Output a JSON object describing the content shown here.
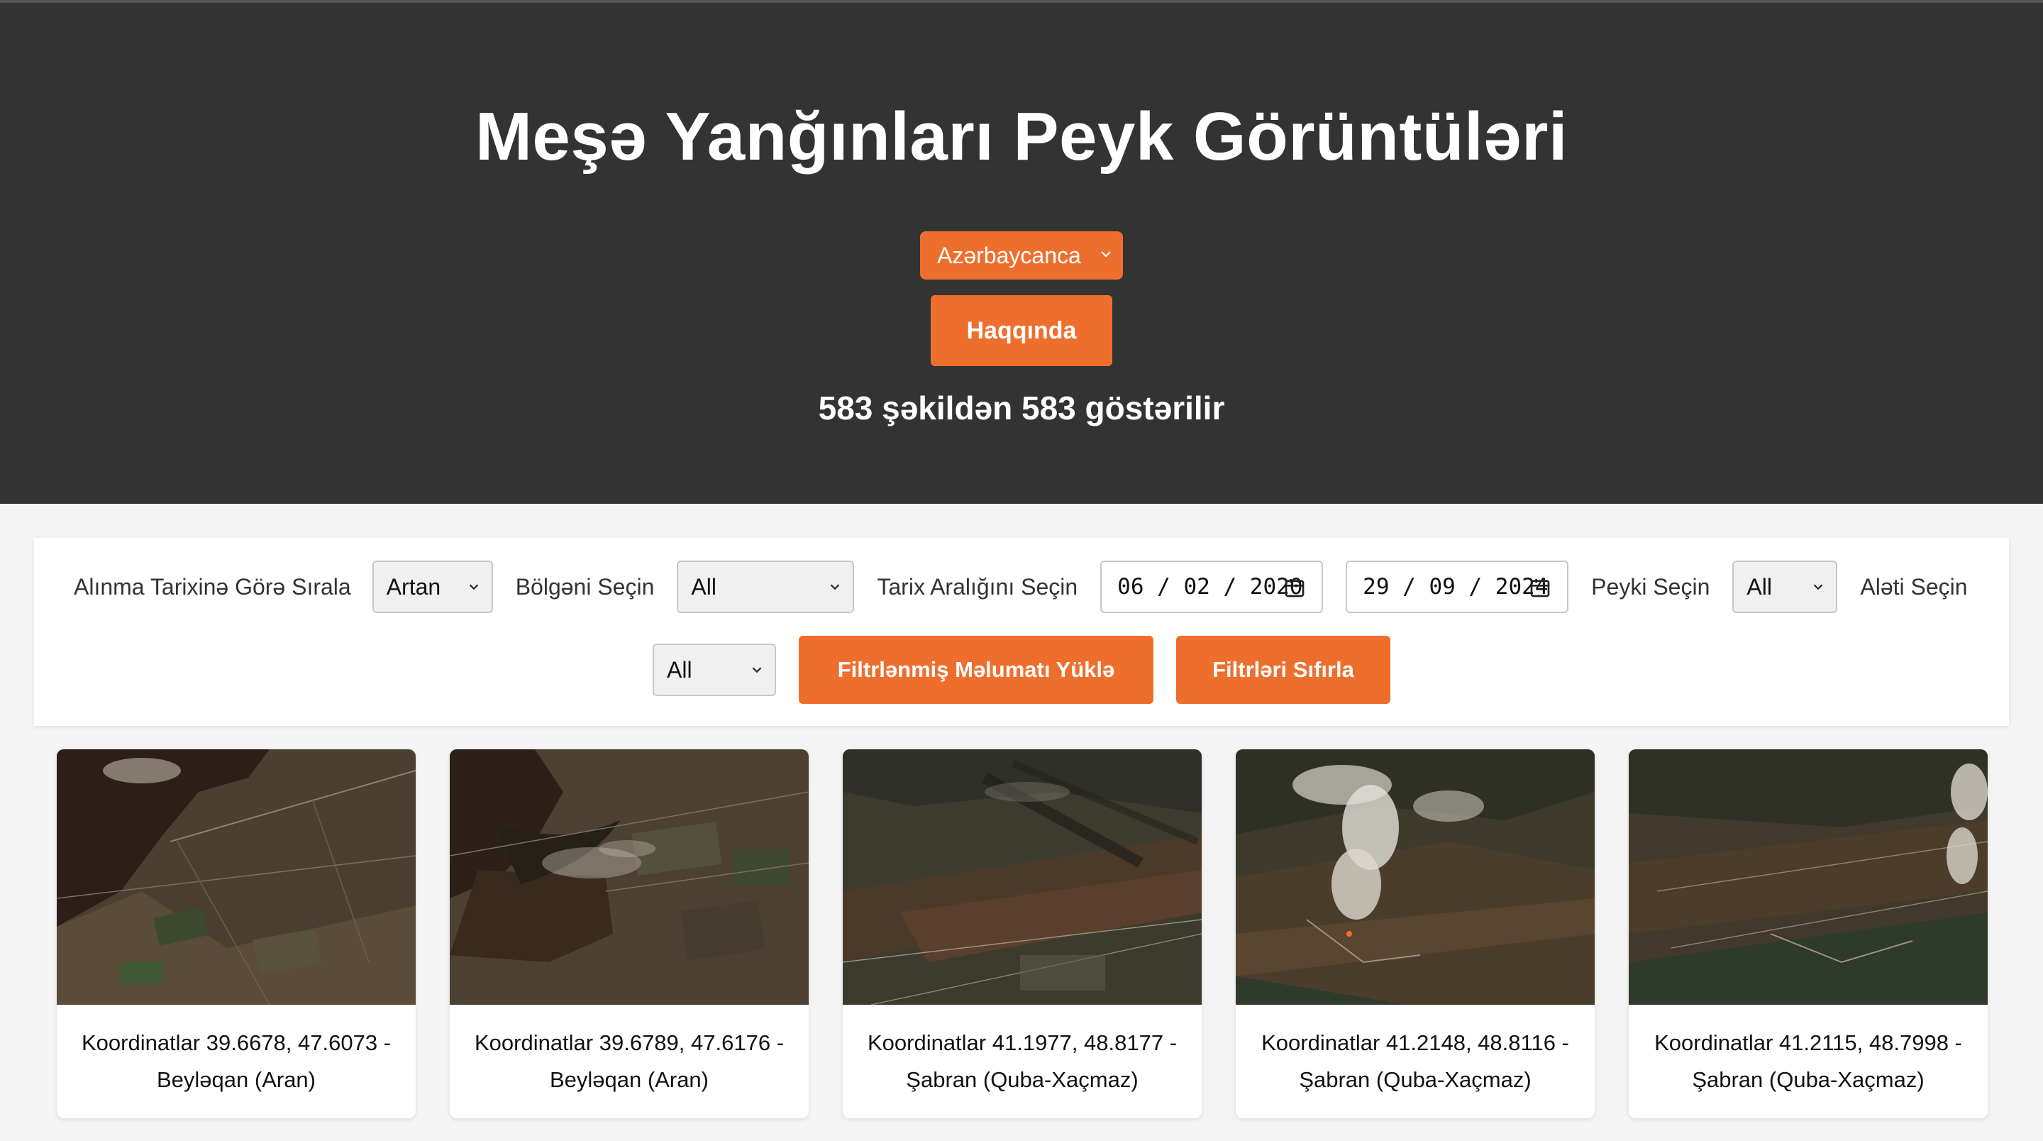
{
  "header": {
    "title": "Meşə Yanğınları Peyk Görüntüləri",
    "language_selected": "Azərbaycanca",
    "about_label": "Haqqında",
    "count_text": "583 şəkildən 583 göstərilir"
  },
  "filters": {
    "sort_label": "Alınma Tarixinə Görə Sırala",
    "sort_value": "Artan",
    "region_label": "Bölgəni Seçin",
    "region_value": "All",
    "date_range_label": "Tarix Aralığını Seçin",
    "date_from": "06 / 02 / 2020",
    "date_to": "29 / 09 / 2024",
    "satellite_label": "Peyki Seçin",
    "satellite_value": "All",
    "instrument_label": "Aləti Seçin",
    "instrument_value": "All",
    "load_button": "Filtrlənmiş Məlumatı Yüklə",
    "reset_button": "Filtrləri Sıfırla"
  },
  "cards": [
    {
      "line1": "Koordinatlar 39.6678, 47.6073 -",
      "line2": "Beyləqan (Aran)"
    },
    {
      "line1": "Koordinatlar 39.6789, 47.6176 -",
      "line2": "Beyləqan (Aran)"
    },
    {
      "line1": "Koordinatlar 41.1977, 48.8177 -",
      "line2": "Şabran (Quba-Xaçmaz)"
    },
    {
      "line1": "Koordinatlar 41.2148, 48.8116 -",
      "line2": "Şabran (Quba-Xaçmaz)"
    },
    {
      "line1": "Koordinatlar 41.2115, 48.7998 -",
      "line2": "Şabran (Quba-Xaçmaz)"
    }
  ],
  "colors": {
    "header_bg": "#333333",
    "accent": "#ee6f2d",
    "page_bg": "#f4f4f4"
  }
}
